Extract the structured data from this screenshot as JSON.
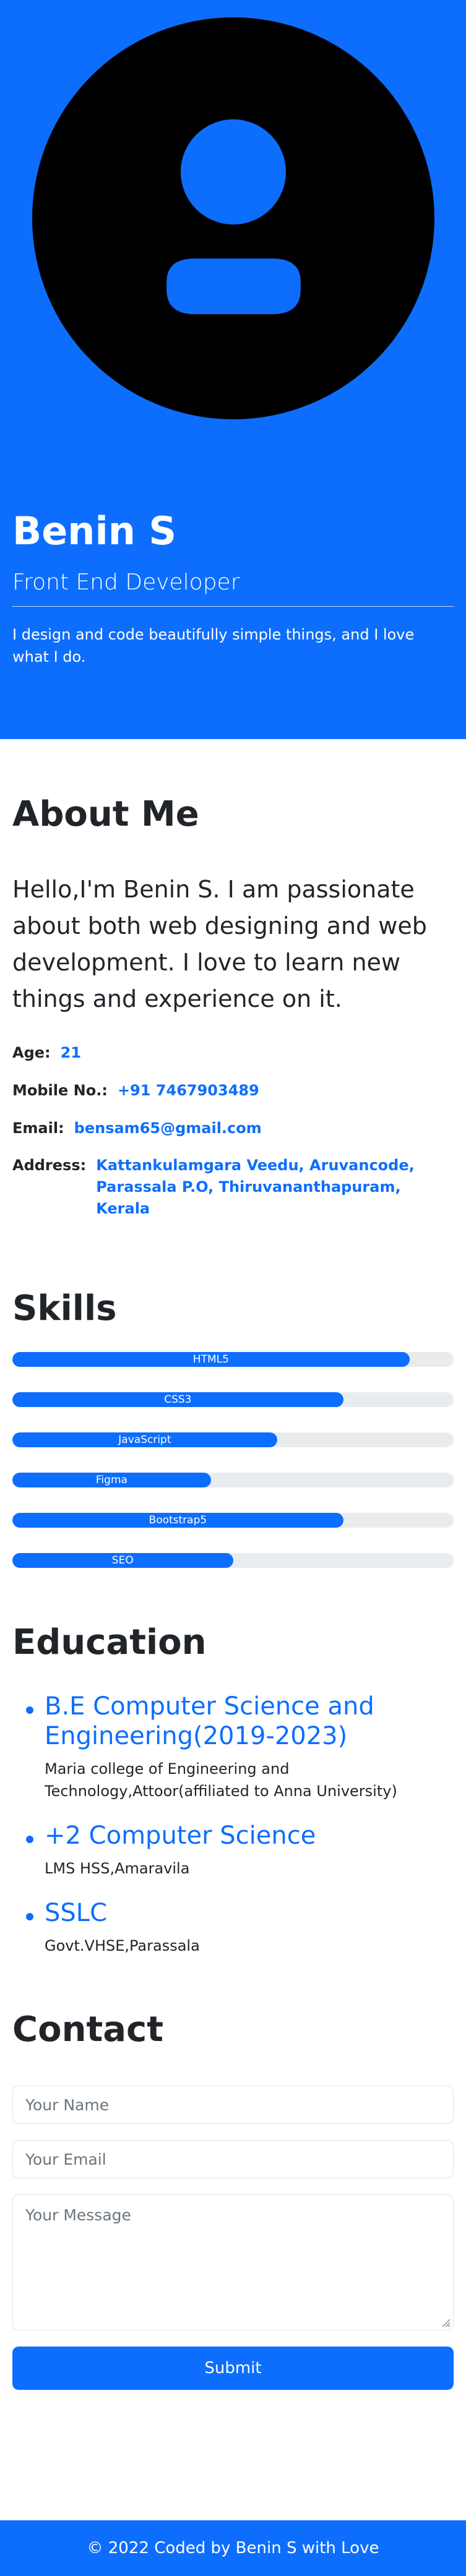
{
  "hero": {
    "name": "Benin S",
    "role": "Front End Developer",
    "tagline": "I design and code beautifully simple things, and I love what I do."
  },
  "about": {
    "title": "About Me",
    "intro": "Hello,I'm Benin S. I am passionate about both web designing and web development. I love to learn new things and experience on it.",
    "details": [
      {
        "label": "Age:",
        "value": "21"
      },
      {
        "label": "Mobile No.:",
        "value": "+91 7467903489"
      },
      {
        "label": "Email:",
        "value": "bensam65@gmail.com"
      },
      {
        "label": "Address:",
        "value": "Kattankulamgara Veedu, Aruvancode, Parassala P.O, Thiruvananthapuram, Kerala"
      }
    ]
  },
  "skills": {
    "title": "Skills",
    "items": [
      {
        "label": "HTML5",
        "percent": 90
      },
      {
        "label": "CSS3",
        "percent": 75
      },
      {
        "label": "JavaScript",
        "percent": 60
      },
      {
        "label": "Figma",
        "percent": 45
      },
      {
        "label": "Bootstrap5",
        "percent": 75
      },
      {
        "label": "SEO",
        "percent": 50
      }
    ]
  },
  "education": {
    "title": "Education",
    "items": [
      {
        "title": "B.E Computer Science and Engineering(2019-2023)",
        "subtitle": "Maria college of Engineering and Technology,Attoor(affiliated to Anna University)"
      },
      {
        "title": "+2 Computer Science",
        "subtitle": "LMS HSS,Amaravila"
      },
      {
        "title": "SSLC",
        "subtitle": "Govt.VHSE,Parassala"
      }
    ]
  },
  "contact": {
    "title": "Contact",
    "name_placeholder": "Your Name",
    "email_placeholder": "Your Email",
    "message_placeholder": "Your Message",
    "submit_label": "Submit"
  },
  "footer": {
    "text": "© 2022 Coded by Benin S with Love"
  },
  "colors": {
    "primary": "#0d6efd",
    "text": "#212529",
    "avatar": "#000000"
  }
}
